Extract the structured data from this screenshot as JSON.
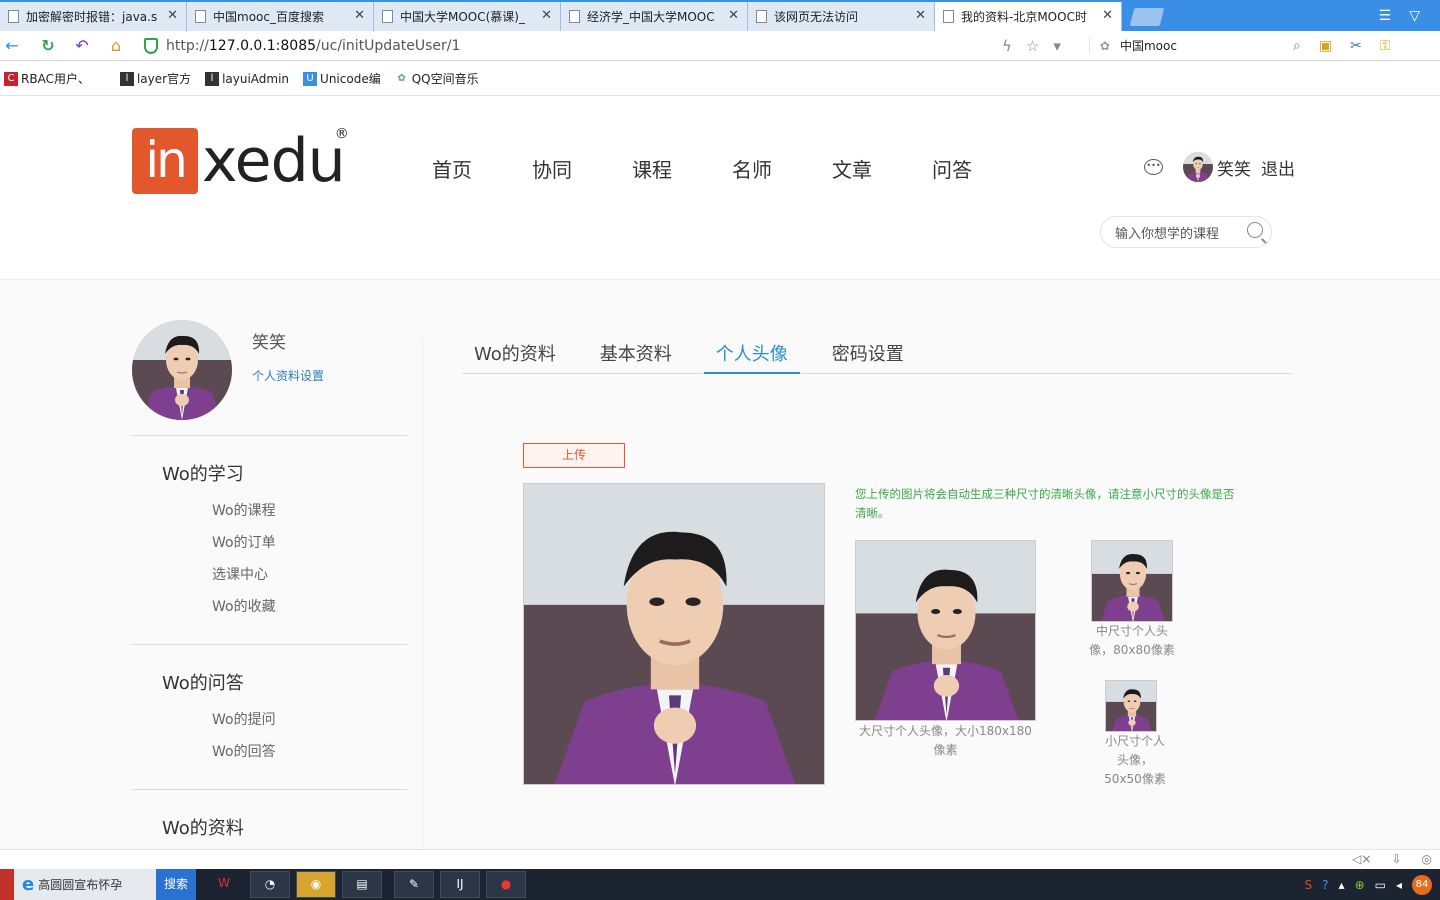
{
  "browser": {
    "tabs": [
      {
        "label": "加密解密时报错：java.s",
        "active": false
      },
      {
        "label": "中国mooc_百度搜索",
        "active": false
      },
      {
        "label": "中国大学MOOC(慕课)_",
        "active": false
      },
      {
        "label": "经济学_中国大学MOOC",
        "active": false
      },
      {
        "label": "该网页无法访问",
        "active": false
      },
      {
        "label": "我的资料-北京MOOC时",
        "active": true
      }
    ],
    "url_prefix": "http://",
    "url_host": "127.0.0.1:8085",
    "url_path": "/uc/initUpdateUser/1",
    "search_text": "中国mooc",
    "bookmarks": [
      "RBAC用户、",
      "layer官方",
      "layuiAdmin",
      "Unicode编",
      "QQ空间音乐"
    ]
  },
  "site": {
    "logo_badge": "in",
    "logo_text": "xedu",
    "logo_reg": "®",
    "nav": [
      "首页",
      "协同",
      "课程",
      "名师",
      "文章",
      "问答"
    ],
    "user_name": "笑笑",
    "logout": "退出",
    "search_placeholder": "输入你想学的课程"
  },
  "profile": {
    "name": "笑笑",
    "settings_link": "个人资料设置"
  },
  "sidebar": {
    "groups": [
      {
        "title": "Wo的学习",
        "items": [
          "Wo的课程",
          "Wo的订单",
          "选课中心",
          "Wo的收藏"
        ]
      },
      {
        "title": "Wo的问答",
        "items": [
          "Wo的提问",
          "Wo的回答"
        ]
      },
      {
        "title": "Wo的资料",
        "items": []
      }
    ]
  },
  "content": {
    "tabs": [
      "Wo的资料",
      "基本资料",
      "个人头像",
      "密码设置"
    ],
    "active_tab": "个人头像",
    "upload_label": "上传",
    "hint": "您上传的图片将会自动生成三种尺寸的清晰头像，请注意小尺寸的头像是否清晰。",
    "caption_large": "大尺寸个人头像，大小180x180像素",
    "caption_medium": "中尺寸个人头像，80x80像素",
    "caption_small": "小尺寸个人头像，50x50像素"
  },
  "taskbar": {
    "ie_label": "高圆圆宣布怀孕",
    "search_label": "搜索",
    "tray_badge": "84"
  },
  "colors": {
    "brand": "#e2572b",
    "link": "#2c7ebc",
    "active_tab": "#2c8fd0",
    "hint": "#3aa64a"
  }
}
